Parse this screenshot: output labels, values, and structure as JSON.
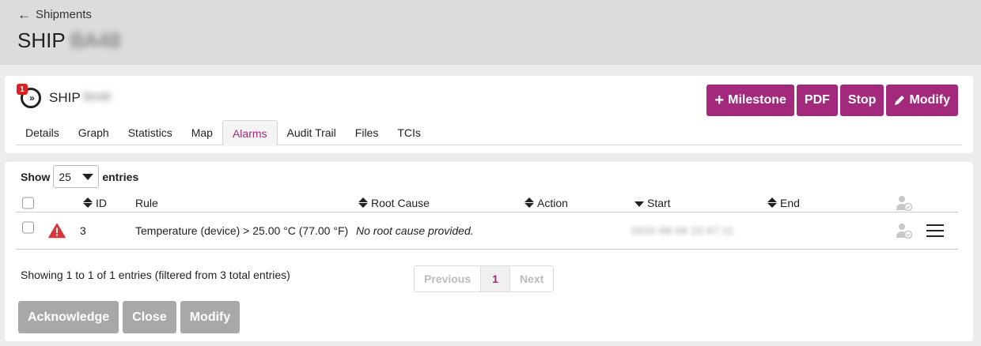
{
  "header": {
    "back_label": "Shipments",
    "title": "SHIP",
    "title_redacted": "BA48"
  },
  "shipment": {
    "name": "SHIP",
    "name_redacted": "BA48",
    "alert_count": "1",
    "icon": "forward-chevrons-icon"
  },
  "actions": {
    "milestone": "Milestone",
    "pdf": "PDF",
    "stop": "Stop",
    "modify": "Modify"
  },
  "tabs": [
    {
      "label": "Details"
    },
    {
      "label": "Graph"
    },
    {
      "label": "Statistics"
    },
    {
      "label": "Map"
    },
    {
      "label": "Alarms",
      "active": true
    },
    {
      "label": "Audit Trail"
    },
    {
      "label": "Files"
    },
    {
      "label": "TCIs"
    }
  ],
  "table_controls": {
    "show_label": "Show",
    "entries_value": "25",
    "entries_label": "entries"
  },
  "table": {
    "columns": {
      "id": "ID",
      "rule": "Rule",
      "root_cause": "Root Cause",
      "action": "Action",
      "start": "Start",
      "end": "End"
    },
    "rows": [
      {
        "id": "3",
        "rule": "Temperature (device) > 25.00 °C (77.00 °F)",
        "root_cause": "No root cause provided.",
        "action": "",
        "start": "2022-08-08 22:47:11",
        "end": ""
      }
    ]
  },
  "footer": {
    "info": "Showing 1 to 1 of 1 entries (filtered from 3 total entries)",
    "prev": "Previous",
    "page": "1",
    "next": "Next"
  },
  "bottom_actions": {
    "acknowledge": "Acknowledge",
    "close": "Close",
    "modify": "Modify"
  },
  "colors": {
    "accent": "#a3297c",
    "alarm": "#d9383a",
    "disabled": "#a8a8a8"
  }
}
